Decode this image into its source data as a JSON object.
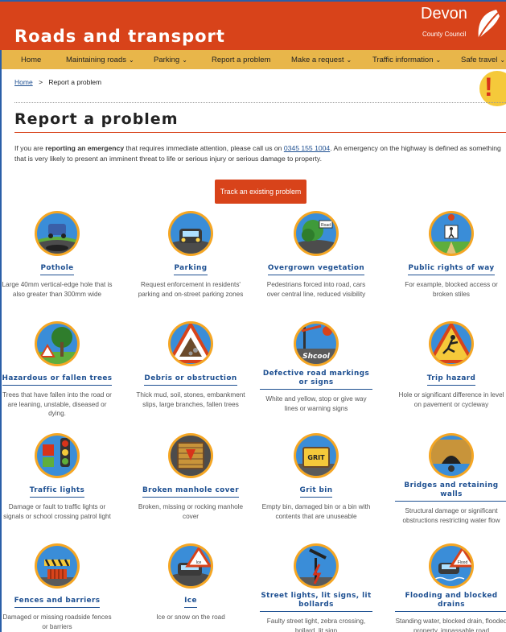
{
  "header": {
    "title": "Roads and transport",
    "logo_word": "Devon",
    "logo_sub": "County Council"
  },
  "nav": [
    {
      "label": "Home",
      "has_menu": false
    },
    {
      "label": "Maintaining roads",
      "has_menu": true
    },
    {
      "label": "Parking",
      "has_menu": true
    },
    {
      "label": "Report a problem",
      "has_menu": false
    },
    {
      "label": "Make a request",
      "has_menu": true
    },
    {
      "label": "Traffic information",
      "has_menu": true
    },
    {
      "label": "Safe travel",
      "has_menu": true
    }
  ],
  "breadcrumb": {
    "home": "Home",
    "separator": ">",
    "current": "Report a problem"
  },
  "page_title": "Report a problem",
  "intro": {
    "part1": "If you are ",
    "bold": "reporting an emergency",
    "part2": " that requires immediate attention, please call us on ",
    "phone": "0345 155 1004",
    "part3": ". An emergency on the highway is defined as something that is very likely to present an imminent threat to life or serious injury or serious damage to property."
  },
  "track_button": "Track an existing problem",
  "colors": {
    "accent": "#d8431a",
    "nav": "#e8b64a",
    "link": "#1d4f91",
    "icon_bg": "#f5a623"
  },
  "tiles": [
    {
      "label": "Pothole",
      "desc": "Large 40mm vertical-edge hole that is also greater than 300mm wide",
      "icon": "pothole-icon"
    },
    {
      "label": "Parking",
      "desc": "Request enforcement in residents' parking and on-street parking zones",
      "icon": "parking-icon"
    },
    {
      "label": "Overgrown vegetation",
      "desc": "Pedestrians forced into road, cars over central line, reduced visibility",
      "icon": "vegetation-icon"
    },
    {
      "label": "Public rights of way",
      "desc": "For example, blocked access or broken stiles",
      "icon": "rights-of-way-icon"
    },
    {
      "label": "Hazardous or fallen trees",
      "desc": "Trees that have fallen into the road or are leaning, unstable, diseased or dying.",
      "icon": "fallen-tree-icon"
    },
    {
      "label": "Debris or obstruction",
      "desc": "Thick mud, soil, stones, embankment slips, large branches, fallen trees",
      "icon": "debris-icon"
    },
    {
      "label": "Defective road markings or signs",
      "desc": "White and yellow, stop or give way lines or warning signs",
      "icon": "road-markings-icon"
    },
    {
      "label": "Trip hazard",
      "desc": "Hole or significant difference in level on pavement or cycleway",
      "icon": "trip-hazard-icon"
    },
    {
      "label": "Traffic lights",
      "desc": "Damage or fault to traffic lights or signals or school crossing patrol light",
      "icon": "traffic-lights-icon"
    },
    {
      "label": "Broken manhole cover",
      "desc": "Broken, missing or rocking manhole cover",
      "icon": "manhole-icon"
    },
    {
      "label": "Grit bin",
      "desc": "Empty bin, damaged bin or a bin with contents that are unuseable",
      "icon": "grit-bin-icon"
    },
    {
      "label": "Bridges and retaining walls",
      "desc": "Structural damage or significant obstructions restricting water flow",
      "icon": "bridge-icon"
    },
    {
      "label": "Fences and barriers",
      "desc": "Damaged or missing roadside fences or barriers",
      "icon": "fence-icon"
    },
    {
      "label": "Ice",
      "desc": "Ice or snow on the road",
      "icon": "ice-icon"
    },
    {
      "label": "Street lights, lit signs, lit bollards",
      "desc": "Faulty street light, zebra crossing, bollard, lit sign",
      "icon": "street-light-icon"
    },
    {
      "label": "Flooding and blocked drains",
      "desc": "Standing water, blocked drain, flooded property, impassable road",
      "icon": "flooding-icon"
    }
  ],
  "icon_text": {
    "road": "Road",
    "school": "Shcool",
    "grit": "GRIT",
    "ice": "Ice",
    "flood": "Flood"
  }
}
